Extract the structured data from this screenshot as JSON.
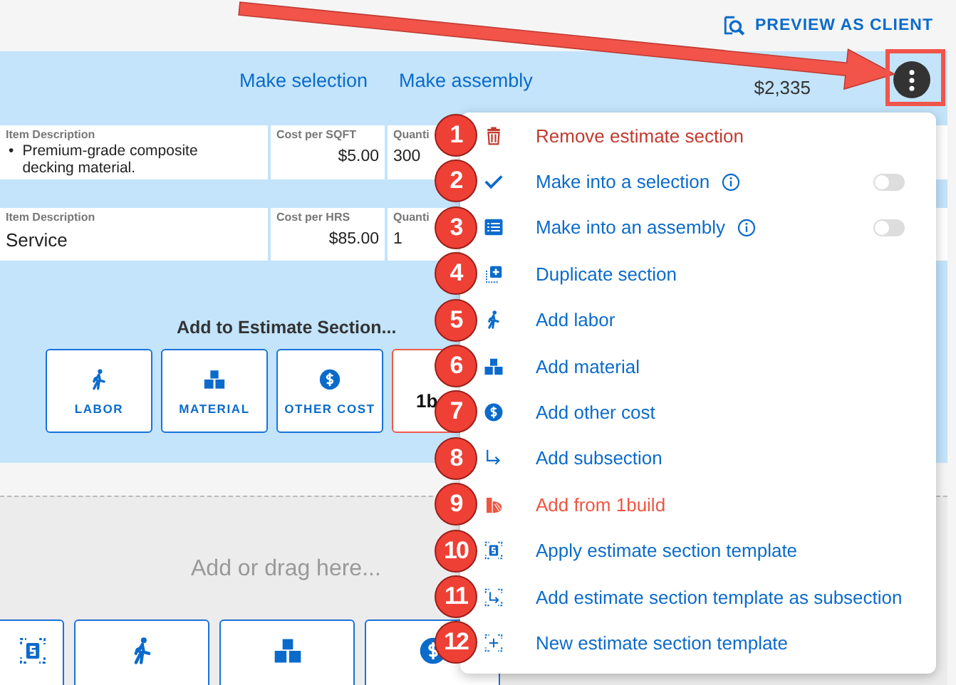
{
  "top_bar": {
    "preview_label": "PREVIEW AS CLIENT"
  },
  "section": {
    "links": [
      "Make selection",
      "Make assembly"
    ],
    "total": "$2,335",
    "items": [
      {
        "cells": [
          {
            "label": "Item Description",
            "bullet": "•",
            "value": "Premium-grade composite decking material.",
            "kind": "bullets"
          },
          {
            "label": "Cost per SQFT",
            "value": "$5.00",
            "kind": "money"
          },
          {
            "label": "Quanti",
            "value": "300",
            "kind": "plain"
          }
        ]
      },
      {
        "cells": [
          {
            "label": "Item Description",
            "value": "Service",
            "kind": "large"
          },
          {
            "label": "Cost per HRS",
            "value": "$85.00",
            "kind": "money"
          },
          {
            "label": "Quanti",
            "value": "1",
            "kind": "plain"
          }
        ]
      }
    ],
    "add_title": "Add to Estimate Section...",
    "add_buttons": [
      {
        "label": "LABOR",
        "kind": "labor"
      },
      {
        "label": "MATERIAL",
        "kind": "material"
      },
      {
        "label": "OTHER COST",
        "kind": "other-cost"
      },
      {
        "label": "1b",
        "kind": "onebuild"
      }
    ]
  },
  "drop_zone": {
    "hint": "Add or drag here...",
    "tiles": [
      {
        "kind": "template"
      },
      {
        "kind": "labor"
      },
      {
        "kind": "material"
      },
      {
        "kind": "other-cost"
      }
    ]
  },
  "menu": {
    "items": [
      {
        "number": "1",
        "label": "Remove estimate section",
        "kind": "remove"
      },
      {
        "number": "2",
        "label": "Make into a selection",
        "kind": "selection",
        "info": true,
        "toggle": {
          "on": false
        }
      },
      {
        "number": "3",
        "label": "Make into an assembly",
        "kind": "assembly",
        "info": true,
        "toggle": {
          "on": false
        }
      },
      {
        "number": "4",
        "label": "Duplicate section",
        "kind": "duplicate"
      },
      {
        "number": "5",
        "label": "Add labor",
        "kind": "labor"
      },
      {
        "number": "6",
        "label": "Add material",
        "kind": "material"
      },
      {
        "number": "7",
        "label": "Add other cost",
        "kind": "other-cost"
      },
      {
        "number": "8",
        "label": "Add subsection",
        "kind": "subsection"
      },
      {
        "number": "9",
        "label": "Add from 1build",
        "kind": "onebuild"
      },
      {
        "number": "10",
        "label": "Apply estimate section template",
        "kind": "template"
      },
      {
        "number": "11",
        "label": "Add estimate section template as subsection",
        "kind": "template-sub"
      },
      {
        "number": "12",
        "label": "New estimate section template",
        "kind": "template-new"
      }
    ]
  }
}
